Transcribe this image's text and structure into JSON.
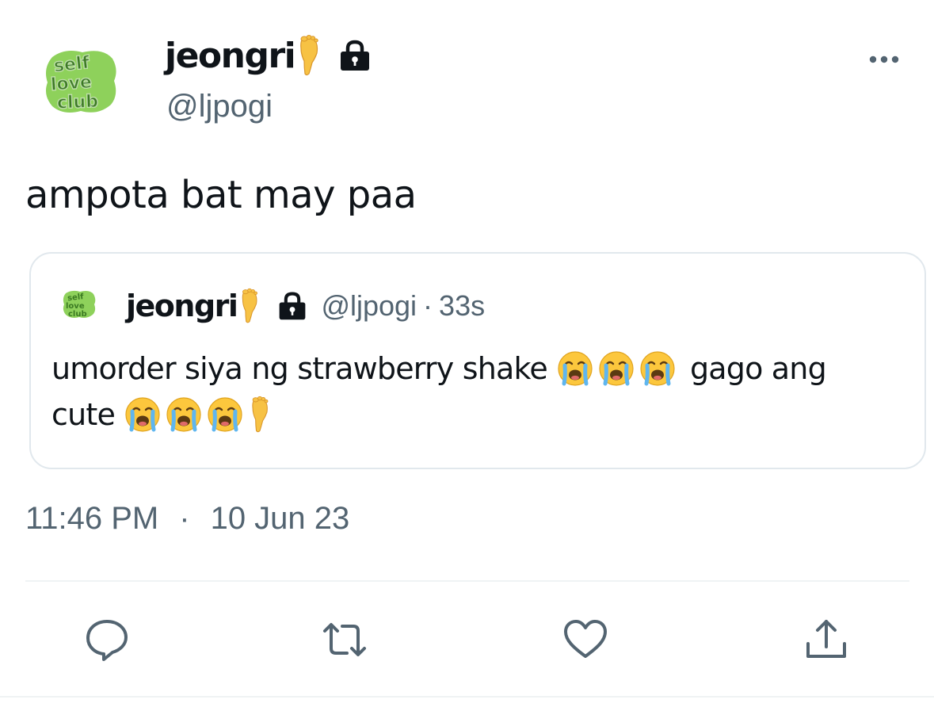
{
  "tweet": {
    "author": {
      "display_name": "jeongri",
      "handle": "@ljpogi",
      "avatar_text": "self love club",
      "verified_icon": "foot-emoji",
      "protected_icon": "lock-icon"
    },
    "text": "ampota bat may paa",
    "quoted_tweet": {
      "author": {
        "display_name": "jeongri",
        "handle": "@ljpogi"
      },
      "separator": "·",
      "time": "33s",
      "body_line1_part1": "umorder siya ng strawberry shake",
      "body_line1_part2": "gago ang",
      "body_line2": "cute",
      "emojis": [
        "loudly-crying-face",
        "foot"
      ]
    },
    "time": "11:46 PM",
    "separator": "·",
    "date": "10 Jun 23",
    "actions": [
      "reply-icon",
      "retweet-icon",
      "like-icon",
      "share-icon"
    ]
  },
  "colors": {
    "text_primary": "#0f1419",
    "text_secondary": "#536471",
    "border": "#e1e8ed",
    "avatar_green": "#8ed15b",
    "avatar_dark": "#2f6b1e"
  }
}
